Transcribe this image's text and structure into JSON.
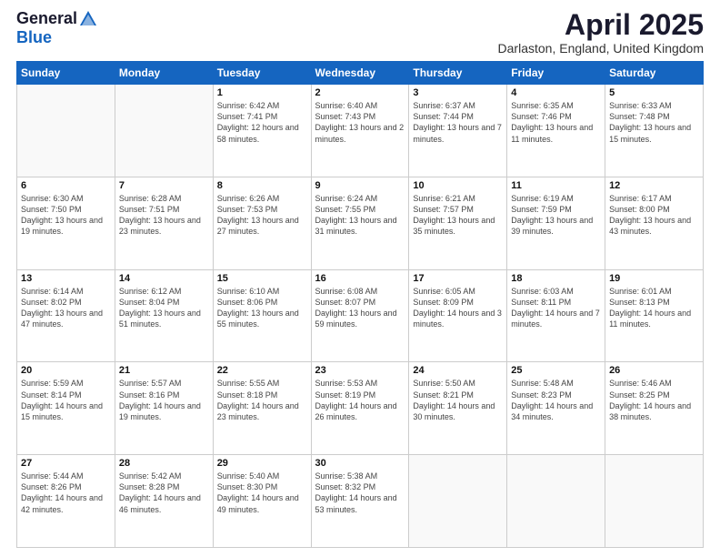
{
  "header": {
    "logo_general": "General",
    "logo_blue": "Blue",
    "title": "April 2025",
    "location": "Darlaston, England, United Kingdom"
  },
  "weekdays": [
    "Sunday",
    "Monday",
    "Tuesday",
    "Wednesday",
    "Thursday",
    "Friday",
    "Saturday"
  ],
  "weeks": [
    [
      {
        "day": "",
        "info": ""
      },
      {
        "day": "",
        "info": ""
      },
      {
        "day": "1",
        "info": "Sunrise: 6:42 AM\nSunset: 7:41 PM\nDaylight: 12 hours and 58 minutes."
      },
      {
        "day": "2",
        "info": "Sunrise: 6:40 AM\nSunset: 7:43 PM\nDaylight: 13 hours and 2 minutes."
      },
      {
        "day": "3",
        "info": "Sunrise: 6:37 AM\nSunset: 7:44 PM\nDaylight: 13 hours and 7 minutes."
      },
      {
        "day": "4",
        "info": "Sunrise: 6:35 AM\nSunset: 7:46 PM\nDaylight: 13 hours and 11 minutes."
      },
      {
        "day": "5",
        "info": "Sunrise: 6:33 AM\nSunset: 7:48 PM\nDaylight: 13 hours and 15 minutes."
      }
    ],
    [
      {
        "day": "6",
        "info": "Sunrise: 6:30 AM\nSunset: 7:50 PM\nDaylight: 13 hours and 19 minutes."
      },
      {
        "day": "7",
        "info": "Sunrise: 6:28 AM\nSunset: 7:51 PM\nDaylight: 13 hours and 23 minutes."
      },
      {
        "day": "8",
        "info": "Sunrise: 6:26 AM\nSunset: 7:53 PM\nDaylight: 13 hours and 27 minutes."
      },
      {
        "day": "9",
        "info": "Sunrise: 6:24 AM\nSunset: 7:55 PM\nDaylight: 13 hours and 31 minutes."
      },
      {
        "day": "10",
        "info": "Sunrise: 6:21 AM\nSunset: 7:57 PM\nDaylight: 13 hours and 35 minutes."
      },
      {
        "day": "11",
        "info": "Sunrise: 6:19 AM\nSunset: 7:59 PM\nDaylight: 13 hours and 39 minutes."
      },
      {
        "day": "12",
        "info": "Sunrise: 6:17 AM\nSunset: 8:00 PM\nDaylight: 13 hours and 43 minutes."
      }
    ],
    [
      {
        "day": "13",
        "info": "Sunrise: 6:14 AM\nSunset: 8:02 PM\nDaylight: 13 hours and 47 minutes."
      },
      {
        "day": "14",
        "info": "Sunrise: 6:12 AM\nSunset: 8:04 PM\nDaylight: 13 hours and 51 minutes."
      },
      {
        "day": "15",
        "info": "Sunrise: 6:10 AM\nSunset: 8:06 PM\nDaylight: 13 hours and 55 minutes."
      },
      {
        "day": "16",
        "info": "Sunrise: 6:08 AM\nSunset: 8:07 PM\nDaylight: 13 hours and 59 minutes."
      },
      {
        "day": "17",
        "info": "Sunrise: 6:05 AM\nSunset: 8:09 PM\nDaylight: 14 hours and 3 minutes."
      },
      {
        "day": "18",
        "info": "Sunrise: 6:03 AM\nSunset: 8:11 PM\nDaylight: 14 hours and 7 minutes."
      },
      {
        "day": "19",
        "info": "Sunrise: 6:01 AM\nSunset: 8:13 PM\nDaylight: 14 hours and 11 minutes."
      }
    ],
    [
      {
        "day": "20",
        "info": "Sunrise: 5:59 AM\nSunset: 8:14 PM\nDaylight: 14 hours and 15 minutes."
      },
      {
        "day": "21",
        "info": "Sunrise: 5:57 AM\nSunset: 8:16 PM\nDaylight: 14 hours and 19 minutes."
      },
      {
        "day": "22",
        "info": "Sunrise: 5:55 AM\nSunset: 8:18 PM\nDaylight: 14 hours and 23 minutes."
      },
      {
        "day": "23",
        "info": "Sunrise: 5:53 AM\nSunset: 8:19 PM\nDaylight: 14 hours and 26 minutes."
      },
      {
        "day": "24",
        "info": "Sunrise: 5:50 AM\nSunset: 8:21 PM\nDaylight: 14 hours and 30 minutes."
      },
      {
        "day": "25",
        "info": "Sunrise: 5:48 AM\nSunset: 8:23 PM\nDaylight: 14 hours and 34 minutes."
      },
      {
        "day": "26",
        "info": "Sunrise: 5:46 AM\nSunset: 8:25 PM\nDaylight: 14 hours and 38 minutes."
      }
    ],
    [
      {
        "day": "27",
        "info": "Sunrise: 5:44 AM\nSunset: 8:26 PM\nDaylight: 14 hours and 42 minutes."
      },
      {
        "day": "28",
        "info": "Sunrise: 5:42 AM\nSunset: 8:28 PM\nDaylight: 14 hours and 46 minutes."
      },
      {
        "day": "29",
        "info": "Sunrise: 5:40 AM\nSunset: 8:30 PM\nDaylight: 14 hours and 49 minutes."
      },
      {
        "day": "30",
        "info": "Sunrise: 5:38 AM\nSunset: 8:32 PM\nDaylight: 14 hours and 53 minutes."
      },
      {
        "day": "",
        "info": ""
      },
      {
        "day": "",
        "info": ""
      },
      {
        "day": "",
        "info": ""
      }
    ]
  ]
}
